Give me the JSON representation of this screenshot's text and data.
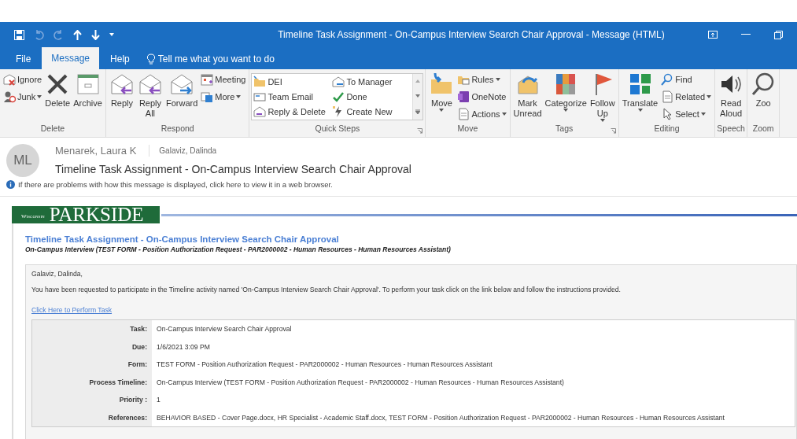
{
  "window": {
    "title": "Timeline Task Assignment - On-Campus Interview Search Chair Approval  -  Message (HTML)"
  },
  "tabs": [
    {
      "label": "File",
      "selected": false
    },
    {
      "label": "Message",
      "selected": true
    },
    {
      "label": "Help",
      "selected": false
    }
  ],
  "tell_me": {
    "placeholder": "Tell me what you want to do"
  },
  "ribbon": [
    {
      "label": "Delete",
      "launcher": false,
      "items": [
        {
          "kind": "stack",
          "items": [
            {
              "label": "Ignore",
              "menu": false
            },
            {
              "label": "Junk",
              "menu": true
            }
          ]
        },
        {
          "kind": "large",
          "label": "Delete",
          "menu": false
        },
        {
          "kind": "large",
          "label": "Archive",
          "menu": false
        }
      ]
    },
    {
      "label": "Respond",
      "launcher": false,
      "items": [
        {
          "kind": "large",
          "label": "Reply",
          "menu": false
        },
        {
          "kind": "large",
          "label": "Reply\nAll",
          "menu": false
        },
        {
          "kind": "large",
          "label": "Forward",
          "menu": false
        },
        {
          "kind": "stack",
          "items": [
            {
              "label": "Meeting",
              "menu": false
            },
            {
              "label": "More",
              "menu": true
            }
          ]
        }
      ]
    },
    {
      "label": "Quick Steps",
      "launcher": true,
      "items": [
        {
          "kind": "gallery",
          "items": [
            {
              "label": "DEI"
            },
            {
              "label": "Team Email"
            },
            {
              "label": "Reply & Delete"
            },
            {
              "label": "To Manager"
            },
            {
              "label": "Done"
            },
            {
              "label": "Create New"
            }
          ]
        }
      ]
    },
    {
      "label": "Move",
      "launcher": false,
      "items": [
        {
          "kind": "large",
          "label": "Move",
          "menu": true
        },
        {
          "kind": "stack",
          "items": [
            {
              "label": "Rules",
              "menu": true
            },
            {
              "label": "OneNote",
              "menu": false
            },
            {
              "label": "Actions",
              "menu": true
            }
          ]
        }
      ]
    },
    {
      "label": "Tags",
      "launcher": true,
      "items": [
        {
          "kind": "large",
          "label": "Mark\nUnread",
          "menu": false
        },
        {
          "kind": "large",
          "label": "Categorize",
          "menu": true
        },
        {
          "kind": "large",
          "label": "Follow\nUp",
          "menu": true
        }
      ]
    },
    {
      "label": "Editing",
      "launcher": false,
      "items": [
        {
          "kind": "large",
          "label": "Translate",
          "menu": true
        },
        {
          "kind": "stack",
          "items": [
            {
              "label": "Find",
              "menu": false
            },
            {
              "label": "Related",
              "menu": true
            },
            {
              "label": "Select",
              "menu": true
            }
          ]
        }
      ]
    },
    {
      "label": "Speech",
      "launcher": false,
      "items": [
        {
          "kind": "large",
          "label": "Read\nAloud",
          "menu": false
        }
      ]
    },
    {
      "label": "Zoom",
      "launcher": false,
      "items": [
        {
          "kind": "large",
          "label": "Zoo",
          "menu": false
        }
      ]
    }
  ],
  "message": {
    "avatar": "ML",
    "sender": "Menarek, Laura K",
    "recipient": "Galaviz, Dalinda",
    "subject": "Timeline Task Assignment - On-Campus Interview Search Chair Approval",
    "info": "If there are problems with how this message is displayed, click here to view it in a web browser."
  },
  "body": {
    "logo_small": "Wisconsin",
    "logo_large": "PARKSIDE",
    "title": "Timeline Task Assignment - On-Campus Interview Search Chair Approval",
    "subtitle": "On-Campus Interview (TEST FORM - Position Authorization Request - PAR2000002 - Human Resources - Human Resources Assistant)",
    "greeting": "Galaviz, Dalinda,",
    "paragraph": "You have been requested to participate in the Timeline activity named 'On-Campus Interview Search Chair Approval'. To perform your task click on the link below and follow the instructions provided.",
    "link": "Click Here to Perform Task",
    "details": [
      {
        "label": "Task:",
        "value": "On-Campus Interview Search Chair Approval"
      },
      {
        "label": "Due:",
        "value": "1/6/2021 3:09 PM"
      },
      {
        "label": "Form:",
        "value": "TEST FORM - Position Authorization Request - PAR2000002 - Human Resources - Human Resources Assistant"
      },
      {
        "label": "Process Timeline:",
        "value": "On-Campus Interview (TEST FORM - Position Authorization Request - PAR2000002 - Human Resources - Human Resources Assistant)"
      },
      {
        "label": "Priority :",
        "value": "1"
      },
      {
        "label": "References:",
        "value": "BEHAVIOR BASED - Cover Page.docx, HR Specialist - Academic Staff.docx, TEST FORM - Position Authorization Request - PAR2000002 - Human Resources - Human Resources Assistant"
      }
    ]
  }
}
